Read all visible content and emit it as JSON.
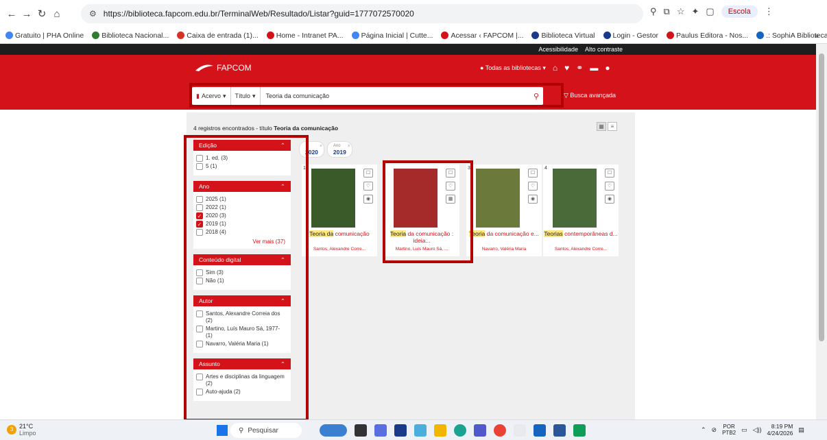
{
  "browser": {
    "url": "https://biblioteca.fapcom.edu.br/TerminalWeb/Resultado/Listar?guid=1777072570020",
    "profile_label": "Escola",
    "bookmarks": [
      {
        "label": "Gratuito | PHA Online",
        "color": "#4285f4"
      },
      {
        "label": "Biblioteca Nacional...",
        "color": "#2e7d32"
      },
      {
        "label": "Caixa de entrada (1)...",
        "color": "#d93025"
      },
      {
        "label": "Home - Intranet PA...",
        "color": "#d3121a"
      },
      {
        "label": "Página Inicial | Cutte...",
        "color": "#4285f4"
      },
      {
        "label": "Acessar ‹ FAPCOM |...",
        "color": "#d3121a"
      },
      {
        "label": "Biblioteca Virtual",
        "color": "#1a3a8a"
      },
      {
        "label": "Login - Gestor",
        "color": "#1a3a8a"
      },
      {
        "label": "Paulus Editora - Nos...",
        "color": "#d3121a"
      },
      {
        "label": ".: SophiA Biblioteca...",
        "color": "#1565c0"
      }
    ],
    "bookmarks_more": "»"
  },
  "site": {
    "access_links": [
      "Acessibilidade",
      "Alto contraste"
    ],
    "logo": "FAPCOM",
    "library_selector": "Todas as bibliotecas",
    "search": {
      "collection": "Acervo",
      "field": "Título",
      "query": "Teoria da comunicação",
      "advanced": "Busca avançada"
    },
    "result_count_prefix": "4 registros encontrados - título",
    "result_count_query": "Teoria da comunicação",
    "chips": [
      {
        "label": "",
        "value": "2020"
      },
      {
        "label": "Ano",
        "value": "2019"
      }
    ],
    "facets": [
      {
        "title": "Edição",
        "items": [
          {
            "label": "1. ed. (3)",
            "checked": false
          },
          {
            "label": "5 (1)",
            "checked": false
          }
        ]
      },
      {
        "title": "Ano",
        "items": [
          {
            "label": "2025 (1)",
            "checked": false
          },
          {
            "label": "2022 (1)",
            "checked": false
          },
          {
            "label": "2020 (3)",
            "checked": true
          },
          {
            "label": "2019 (1)",
            "checked": true
          },
          {
            "label": "2018 (4)",
            "checked": false
          }
        ],
        "more": "Ver mais (37)"
      },
      {
        "title": "Conteúdo digital",
        "items": [
          {
            "label": "Sim (3)",
            "checked": false
          },
          {
            "label": "Não (1)",
            "checked": false
          }
        ]
      },
      {
        "title": "Autor",
        "items": [
          {
            "label": "Santos, Alexandre Correia dos (2)",
            "checked": false
          },
          {
            "label": "Martino, Luís Mauro Sá, 1977- (1)",
            "checked": false
          },
          {
            "label": "Navarro, Valéria Maria (1)",
            "checked": false
          }
        ]
      },
      {
        "title": "Assunto",
        "items": [
          {
            "label": "Artes e disciplinas da linguagem (2)",
            "checked": false
          },
          {
            "label": "Auto-ajuda (2)",
            "checked": false
          }
        ]
      }
    ],
    "results": [
      {
        "num": "1",
        "title_hl": "Teoria da",
        "title_rest": "comunicação",
        "author": "Santos, Alexandre Corre...",
        "cover_color": "#3a5a2a"
      },
      {
        "num": "",
        "title_hl": "Teoria",
        "title_rest": "da comunicação : ideia...",
        "author": "Martino, Luís Mauro Sá, ...",
        "cover_color": "#a52a2a"
      },
      {
        "num": "3",
        "title_hl": "Teoria",
        "title_rest": "da comunicação e...",
        "author": "Navarro, Valéria Maria",
        "cover_color": "#6b7a3a"
      },
      {
        "num": "4",
        "title_hl": "Teorias",
        "title_rest": "contemporâneas d...",
        "author": "Santos, Alexandre Corre...",
        "cover_color": "#4a6a3a"
      }
    ]
  },
  "taskbar": {
    "temp": "21°C",
    "weather": "Limpo",
    "search_placeholder": "Pesquisar",
    "lang_top": "POR",
    "lang_bottom": "PTB2",
    "time": "8:19 PM",
    "date": "4/24/2026"
  }
}
